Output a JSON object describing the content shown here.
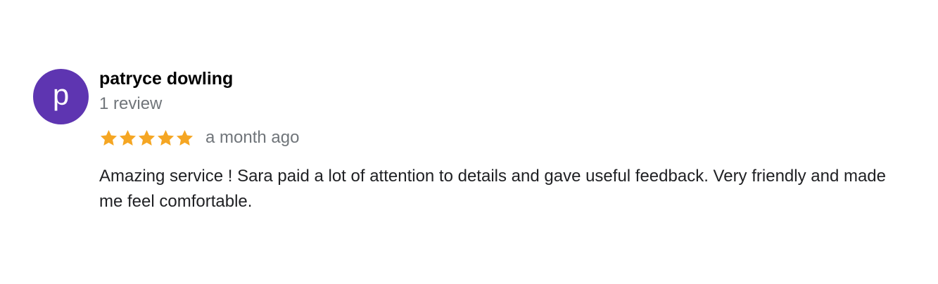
{
  "review": {
    "avatar": {
      "letter": "p",
      "color": "#5e35b1"
    },
    "author_name": "patryce dowling",
    "author_meta": "1 review",
    "rating": 5,
    "max_rating": 5,
    "star_color": "#f5a623",
    "time_ago": "a month ago",
    "text": "Amazing service ! Sara paid a lot of attention to details and gave useful feedback. Very friendly and made me feel comfortable."
  }
}
